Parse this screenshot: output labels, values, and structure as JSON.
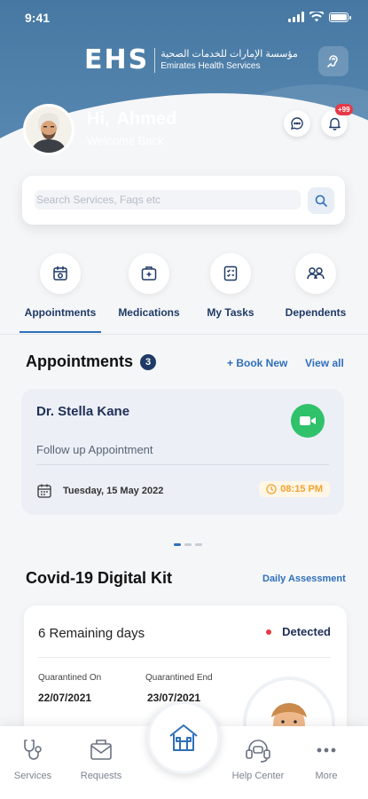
{
  "status_bar": {
    "time": "9:41"
  },
  "header": {
    "logo_mark": "EHS",
    "logo_text_ar": "مؤسسة الإمارات للخدمات الصحية",
    "logo_text_en": "Emirates Health Services",
    "greeting_prefix": "Hi,",
    "user_name": "Ahmed",
    "welcome": "Welcome Back",
    "notification_count": "+99"
  },
  "search": {
    "placeholder": "Search Services, Faqs etc"
  },
  "tabs": [
    {
      "label": "Appointments",
      "icon": "calendar-icon",
      "active": true
    },
    {
      "label": "Medications",
      "icon": "medkit-icon",
      "active": false
    },
    {
      "label": "My Tasks",
      "icon": "checklist-icon",
      "active": false
    },
    {
      "label": "Dependents",
      "icon": "people-icon",
      "active": false
    }
  ],
  "appointments": {
    "title": "Appointments",
    "count": "3",
    "book_new": "+ Book New",
    "view_all": "View all",
    "card": {
      "doctor": "Dr. Stella Kane",
      "type": "Follow up Appointment",
      "date": "Tuesday, 15 May 2022",
      "time": "08:15 PM"
    },
    "carousel_pages": 3,
    "carousel_active": 0
  },
  "covid": {
    "title": "Covid-19 Digital Kit",
    "daily_assessment": "Daily Assessment",
    "remaining": "6 Remaining days",
    "status": "Detected",
    "quarantined_on_label": "Quarantined On",
    "quarantined_on": "22/07/2021",
    "quarantined_end_label": "Quarantined End",
    "quarantined_end": "23/07/2021"
  },
  "bottom_nav": [
    {
      "label": "Services",
      "icon": "stethoscope-icon"
    },
    {
      "label": "Requests",
      "icon": "requests-icon"
    },
    {
      "label": "Help Center",
      "icon": "headset-icon"
    },
    {
      "label": "More",
      "icon": "more-icon"
    }
  ],
  "colors": {
    "header": "#4678a3",
    "accent": "#2f6fba",
    "navy": "#1f3a66",
    "video": "#2fc26b",
    "alert": "#e63946",
    "time_badge": "#f2a22e"
  }
}
